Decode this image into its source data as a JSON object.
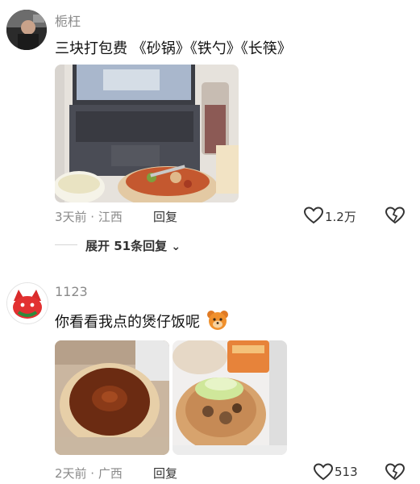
{
  "comments": [
    {
      "username": "栀枉",
      "text": "三块打包费 《砂锅》《铁勺》《长筷》",
      "time_location": "3天前 · 江西",
      "reply_label": "回复",
      "like_count": "1.2万",
      "expand_label": "展开 51条回复",
      "expand_chevron": "⌄"
    },
    {
      "username": "1123",
      "text": "你看看我点的煲仔饭呢",
      "time_location": "2天前 · 广西",
      "reply_label": "回复",
      "like_count": "513"
    }
  ],
  "icons": {
    "like": "heart-outline-icon",
    "dislike": "broken-heart-icon",
    "emoji": "bear-face-emoji",
    "expand": "chevron-down-icon"
  },
  "colors": {
    "text_primary": "#111111",
    "text_secondary": "#8a8a8a",
    "divider": "#d6d6d6"
  }
}
